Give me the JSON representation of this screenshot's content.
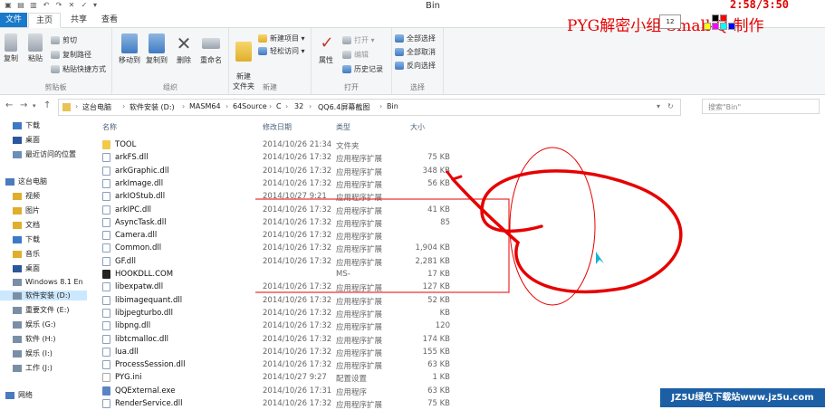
{
  "window": {
    "title": "Bin"
  },
  "tabs": {
    "file": "文件",
    "home": "主页",
    "share": "共享",
    "view": "查看"
  },
  "ribbon": {
    "clipboard": {
      "label": "剪贴板",
      "copy": "复制",
      "paste": "粘贴",
      "cut": "剪切",
      "copy_path": "复制路径",
      "paste_shortcut": "粘贴快捷方式"
    },
    "organize": {
      "label": "组织",
      "move_to": "移动到",
      "copy_to": "复制到",
      "delete": "删除",
      "rename": "重命名"
    },
    "new": {
      "label": "新建",
      "new_folder": "新建\n文件夹",
      "new_item": "新建项目 ▾",
      "easy_access": "轻松访问 ▾"
    },
    "open": {
      "label": "打开",
      "properties": "属性",
      "open": "打开 ▾",
      "edit": "编辑",
      "history": "历史记录"
    },
    "select": {
      "label": "选择",
      "select_all": "全部选择",
      "select_none": "全部取消",
      "invert": "反向选择"
    }
  },
  "address": {
    "crumbs": [
      "这台电脑",
      "软件安装 (D:)",
      "MASM64",
      "64Source",
      "C",
      "32",
      "QQ6.4屏幕截图",
      "Bin"
    ],
    "search_placeholder": "搜索\"Bin\""
  },
  "nav": {
    "items": [
      "下载",
      "桌面",
      "最近访问的位置",
      "这台电脑",
      "视频",
      "图片",
      "文档",
      "下载",
      "音乐",
      "桌面",
      "Windows 8.1 En",
      "软件安装 (D:)",
      "重要文件 (E:)",
      "娱乐 (G:)",
      "软件 (H:)",
      "娱乐 (I:)",
      "工作 (J:)",
      "网络"
    ]
  },
  "columns": {
    "name": "名称",
    "date": "修改日期",
    "type": "类型",
    "size": "大小"
  },
  "files": [
    {
      "name": "TOOL",
      "date": "2014/10/26 21:34",
      "type": "文件夹",
      "size": "",
      "kind": "dir"
    },
    {
      "name": "arkFS.dll",
      "date": "2014/10/26 17:32",
      "type": "应用程序扩展",
      "size": "75 KB",
      "kind": "dll"
    },
    {
      "name": "arkGraphic.dll",
      "date": "2014/10/26 17:32",
      "type": "应用程序扩展",
      "size": "348 KB",
      "kind": "dll"
    },
    {
      "name": "arkImage.dll",
      "date": "2014/10/26 17:32",
      "type": "应用程序扩展",
      "size": "56 KB",
      "kind": "dll"
    },
    {
      "name": "arkIOStub.dll",
      "date": "2014/10/27 9:21",
      "type": "应用程序扩展",
      "size": "",
      "kind": "dll"
    },
    {
      "name": "arkIPC.dll",
      "date": "2014/10/26 17:32",
      "type": "应用程序扩展",
      "size": "41 KB",
      "kind": "dll"
    },
    {
      "name": "AsyncTask.dll",
      "date": "2014/10/26 17:32",
      "type": "应用程序扩展",
      "size": "85",
      "kind": "dll"
    },
    {
      "name": "Camera.dll",
      "date": "2014/10/26 17:32",
      "type": "应用程序扩展",
      "size": "",
      "kind": "dll"
    },
    {
      "name": "Common.dll",
      "date": "2014/10/26 17:32",
      "type": "应用程序扩展",
      "size": "1,904 KB",
      "kind": "dll"
    },
    {
      "name": "GF.dll",
      "date": "2014/10/26 17:32",
      "type": "应用程序扩展",
      "size": "2,281 KB",
      "kind": "dll"
    },
    {
      "name": "HOOKDLL.COM",
      "date": "",
      "type": "MS-",
      "size": "17 KB",
      "kind": "com"
    },
    {
      "name": "libexpatw.dll",
      "date": "2014/10/26 17:32",
      "type": "应用程序扩展",
      "size": "127 KB",
      "kind": "dll"
    },
    {
      "name": "libimagequant.dll",
      "date": "2014/10/26 17:32",
      "type": "应用程序扩展",
      "size": "52 KB",
      "kind": "dll"
    },
    {
      "name": "libjpegturbo.dll",
      "date": "2014/10/26 17:32",
      "type": "应用程序扩展",
      "size": "KB",
      "kind": "dll"
    },
    {
      "name": "libpng.dll",
      "date": "2014/10/26 17:32",
      "type": "应用程序扩展",
      "size": "120",
      "kind": "dll"
    },
    {
      "name": "libtcmalloc.dll",
      "date": "2014/10/26 17:32",
      "type": "应用程序扩展",
      "size": "174 KB",
      "kind": "dll"
    },
    {
      "name": "lua.dll",
      "date": "2014/10/26 17:32",
      "type": "应用程序扩展",
      "size": "155 KB",
      "kind": "dll"
    },
    {
      "name": "ProcessSession.dll",
      "date": "2014/10/26 17:32",
      "type": "应用程序扩展",
      "size": "63 KB",
      "kind": "dll"
    },
    {
      "name": "PYG.ini",
      "date": "2014/10/27 9:27",
      "type": "配置设置",
      "size": "1 KB",
      "kind": "ini"
    },
    {
      "name": "QQExternal.exe",
      "date": "2014/10/26 17:31",
      "type": "应用程序",
      "size": "63 KB",
      "kind": "exe"
    },
    {
      "name": "RenderService.dll",
      "date": "2014/10/26 17:32",
      "type": "应用程序扩展",
      "size": "75 KB",
      "kind": "dll"
    }
  ],
  "overlay": {
    "title": "PYG解密小组 Small-Q 制作",
    "clock": "2:58/3:50",
    "font_size": "12"
  },
  "watermark": {
    "text": "JZ5U绿色下载站www.jz5u.com"
  },
  "colors": {
    "accent": "#1979ca",
    "annotation": "#e60000"
  }
}
